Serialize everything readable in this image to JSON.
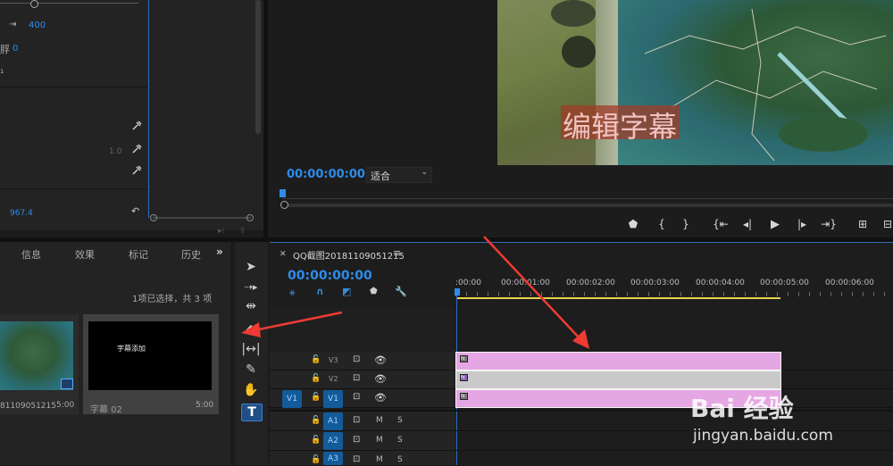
{
  "effect_controls": {
    "row1_value": "400",
    "row2_label": "脬",
    "row2_value": "0",
    "row3_label": "₁",
    "opacity_value": "1.0",
    "bottom_value": "967.4"
  },
  "program_monitor": {
    "timecode": "00:00:00:00",
    "fit_label": "适合",
    "caption_text": "编辑字幕"
  },
  "project_panel": {
    "tabs": [
      "信息",
      "效果",
      "标记",
      "历史"
    ],
    "selection_text": "1项已选择，共 3 项",
    "items": [
      {
        "name": "81109051215",
        "duration": "5:00"
      },
      {
        "name": "字幕 02",
        "duration": "5:00",
        "thumb_text": "字幕添加"
      }
    ]
  },
  "timeline": {
    "tab_label": "QQ截图20181109051215",
    "timecode": "00:00:00:00",
    "ruler": [
      ":00:00",
      "00:00:01:00",
      "00:00:02:00",
      "00:00:03:00",
      "00:00:04:00",
      "00:00:05:00",
      "00:00:06:00"
    ],
    "tracks": [
      {
        "name": "V3",
        "kind": "video"
      },
      {
        "name": "V2",
        "kind": "video"
      },
      {
        "name": "V1",
        "kind": "video",
        "source": "V1"
      },
      {
        "name": "A1",
        "kind": "audio"
      },
      {
        "name": "A2",
        "kind": "audio"
      },
      {
        "name": "A3",
        "kind": "audio"
      }
    ],
    "clips": [
      {
        "track": "V3",
        "color": "#e5a7e3"
      },
      {
        "track": "V2",
        "color": "#c9c9c9"
      },
      {
        "track": "V1",
        "color": "#e5a7e3"
      }
    ]
  },
  "watermark": {
    "logo_text": "Bai 经验",
    "url": "jingyan.baidu.com"
  },
  "colors": {
    "accent": "#2d8ceb",
    "annotation_arrow": "#ee3b34",
    "clip_pink": "#e5a7e3",
    "clip_gray": "#c9c9c9"
  }
}
